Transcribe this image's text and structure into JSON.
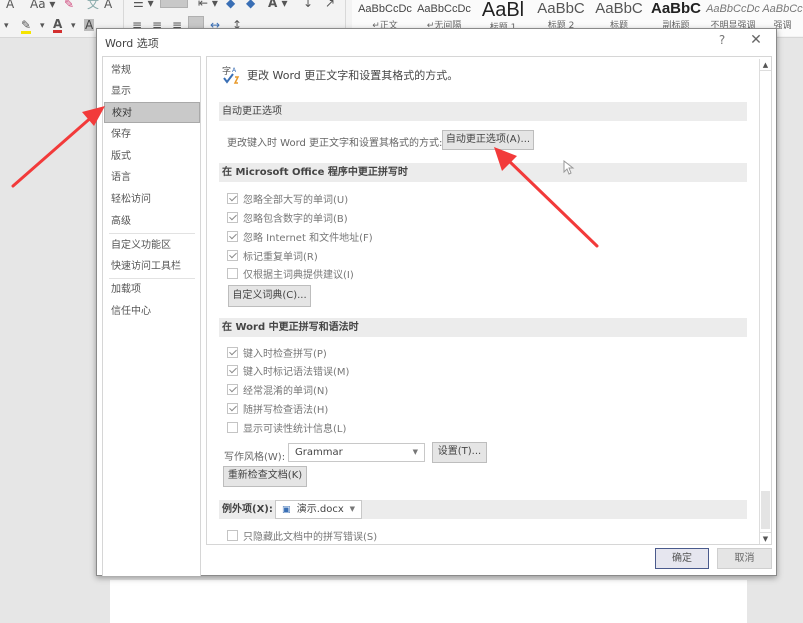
{
  "ribbon": {
    "styles": [
      {
        "sample": "AaBbCcDc",
        "name": "↵正文",
        "variant": "normal"
      },
      {
        "sample": "AaBbCcDc",
        "name": "↵无间隔",
        "variant": "normal"
      },
      {
        "sample": "AaBl",
        "name": "标题 1",
        "variant": "big"
      },
      {
        "sample": "AaBbC",
        "name": "标题 2",
        "variant": "light"
      },
      {
        "sample": "AaBbC",
        "name": "标题",
        "variant": "light"
      },
      {
        "sample": "AaBbC",
        "name": "副标题",
        "variant": "bold"
      },
      {
        "sample": "AaBbCcDc",
        "name": "不明显强调",
        "variant": "italic"
      },
      {
        "sample": "AaBbCc",
        "name": "强调",
        "variant": "italic"
      }
    ],
    "font_color_accent": "#d32f2f",
    "highlight_accent": "#f5e400"
  },
  "dialog": {
    "title": "Word 选项",
    "help_label": "?",
    "close_label": "✕",
    "nav": [
      {
        "label": "常规",
        "selected": false
      },
      {
        "label": "显示",
        "selected": false
      },
      {
        "label": "校对",
        "selected": true
      },
      {
        "label": "保存",
        "selected": false
      },
      {
        "label": "版式",
        "selected": false
      },
      {
        "label": "语言",
        "selected": false
      },
      {
        "label": "轻松访问",
        "selected": false
      },
      {
        "label": "高级",
        "selected": false
      },
      {
        "label": "自定义功能区",
        "selected": false
      },
      {
        "label": "快速访问工具栏",
        "selected": false
      },
      {
        "label": "加载项",
        "selected": false
      },
      {
        "label": "信任中心",
        "selected": false
      }
    ],
    "content": {
      "header": "更改 Word 更正文字和设置其格式的方式。",
      "autocorrect_section": {
        "title": "自动更正选项",
        "description": "更改键入时 Word 更正文字和设置其格式的方式:",
        "button": "自动更正选项(A)..."
      },
      "office_section": {
        "title": "在 Microsoft Office 程序中更正拼写时",
        "options": [
          {
            "label": "忽略全部大写的单词(U)",
            "checked": true
          },
          {
            "label": "忽略包含数字的单词(B)",
            "checked": true
          },
          {
            "label": "忽略 Internet 和文件地址(F)",
            "checked": true
          },
          {
            "label": "标记重复单词(R)",
            "checked": true
          },
          {
            "label": "仅根据主词典提供建议(I)",
            "checked": false
          }
        ],
        "custom_dict_button": "自定义词典(C)..."
      },
      "word_section": {
        "title": "在 Word 中更正拼写和语法时",
        "options": [
          {
            "label": "键入时检查拼写(P)",
            "checked": true
          },
          {
            "label": "键入时标记语法错误(M)",
            "checked": true
          },
          {
            "label": "经常混淆的单词(N)",
            "checked": true
          },
          {
            "label": "随拼写检查语法(H)",
            "checked": true
          },
          {
            "label": "显示可读性统计信息(L)",
            "checked": false
          }
        ],
        "writing_style_label": "写作风格(W):",
        "writing_style_value": "Grammar",
        "settings_button": "设置(T)...",
        "recheck_button": "重新检查文档(K)"
      },
      "exceptions_section": {
        "title": "例外项(X):",
        "document": "演示.docx",
        "options": [
          {
            "label": "只隐藏此文档中的拼写错误(S)",
            "checked": false
          }
        ]
      }
    },
    "ok_label": "确定",
    "cancel_label": "取消"
  },
  "annotations": {
    "arrow_color": "#f23a3a"
  }
}
